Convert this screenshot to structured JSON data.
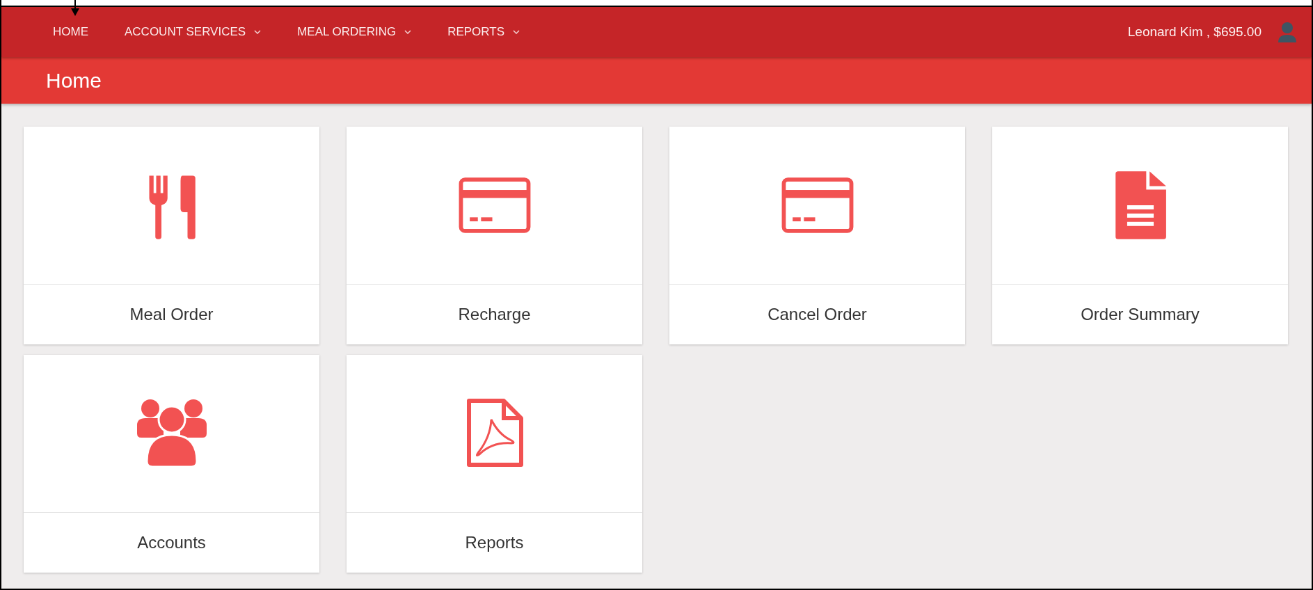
{
  "nav": {
    "items": [
      {
        "label": "HOME",
        "dropdown": false,
        "pointer": true
      },
      {
        "label": "ACCOUNT SERVICES",
        "dropdown": true,
        "pointer": false
      },
      {
        "label": "MEAL ORDERING",
        "dropdown": true,
        "pointer": false
      },
      {
        "label": "REPORTS",
        "dropdown": true,
        "pointer": false
      }
    ],
    "user": "Leonard Kim , $695.00"
  },
  "page_title": "Home",
  "tiles": [
    {
      "label": "Meal Order",
      "kind": "cutlery"
    },
    {
      "label": "Recharge",
      "kind": "card"
    },
    {
      "label": "Cancel Order",
      "kind": "card"
    },
    {
      "label": "Order Summary",
      "kind": "document"
    },
    {
      "label": "Accounts",
      "kind": "users"
    },
    {
      "label": "Reports",
      "kind": "pdf"
    }
  ]
}
